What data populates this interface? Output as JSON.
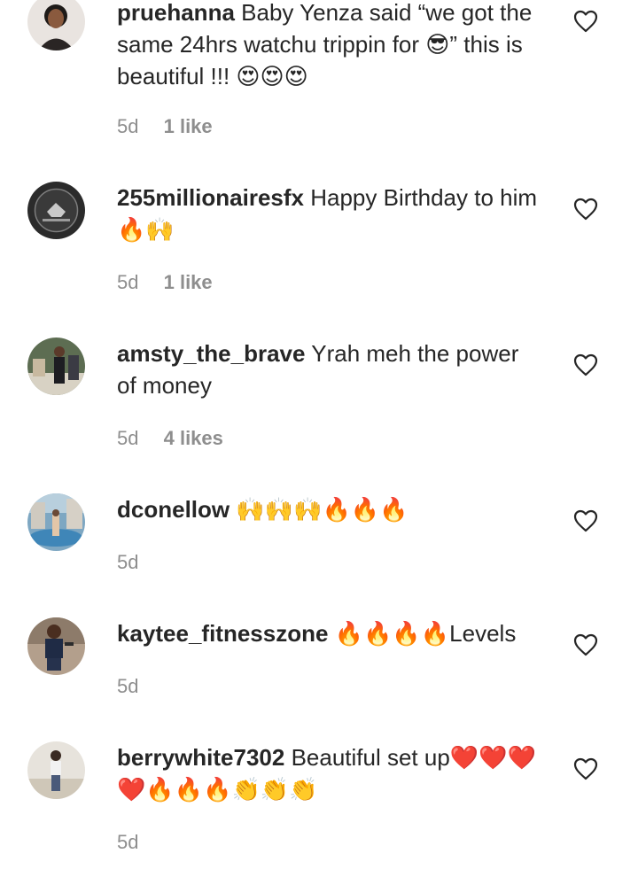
{
  "comments": [
    {
      "username": "pruehanna",
      "text": "Baby Yenza said “we got the same 24hrs watchu trippin for 😎” this is beautiful !!! 😍😍😍",
      "time": "5d",
      "likes": "1 like",
      "avatar": "woman-portrait"
    },
    {
      "username": "255millionairesfx",
      "text": "Happy Birthday to him 🔥🙌",
      "time": "5d",
      "likes": "1 like",
      "avatar": "dark-logo-badge"
    },
    {
      "username": "amsty_the_brave",
      "text": "Yrah meh the power of money",
      "time": "5d",
      "likes": "4 likes",
      "avatar": "man-at-event"
    },
    {
      "username": "dconellow",
      "text": "🙌🙌🙌🔥🔥🔥",
      "time": "5d",
      "likes": "",
      "avatar": "person-by-pool"
    },
    {
      "username": "kaytee_fitnesszone",
      "text": "🔥🔥🔥🔥Levels",
      "time": "5d",
      "likes": "",
      "avatar": "man-in-gym"
    },
    {
      "username": "berrywhite7302",
      "text": "Beautiful set up❤️❤️❤️❤️🔥🔥🔥👏👏👏",
      "time": "5d",
      "likes": "",
      "avatar": "man-standing-outdoor"
    }
  ],
  "icons": {
    "like": "heart-outline-icon"
  },
  "colors": {
    "text": "#262626",
    "meta": "#8e8e8e",
    "background": "#ffffff"
  }
}
